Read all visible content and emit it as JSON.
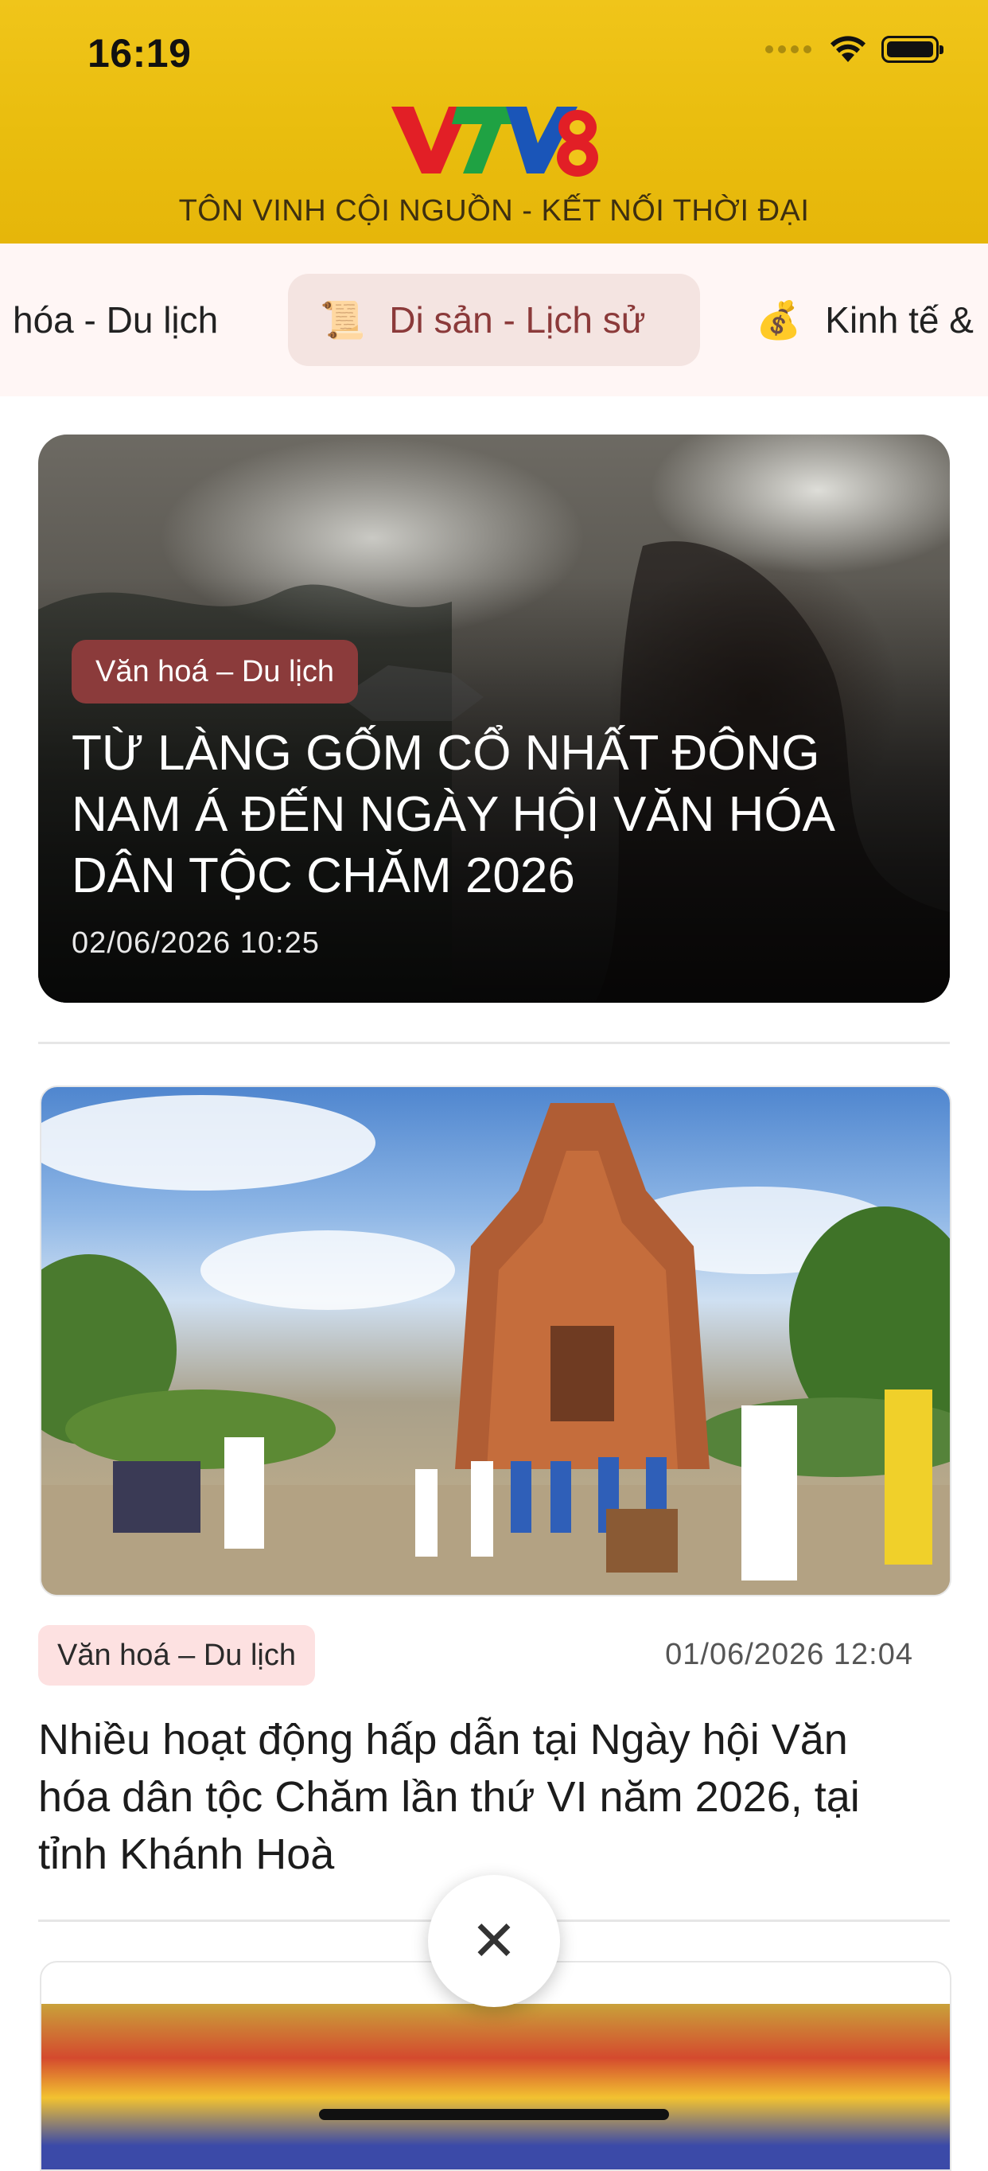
{
  "status_bar": {
    "time": "16:19",
    "icons": [
      "signal-icon",
      "wifi-icon",
      "battery-icon"
    ]
  },
  "header": {
    "logo_text": "VTV8",
    "tagline": "TÔN VINH CỘI NGUỒN - KẾT NỐI THỜI ĐẠI",
    "background_color": "#e9bd0e"
  },
  "tabs": [
    {
      "emoji": "",
      "label": "hóa - Du lịch",
      "selected": false
    },
    {
      "emoji": "📜",
      "label": "Di sản - Lịch sử",
      "selected": true
    },
    {
      "emoji": "💰",
      "label": "Kinh tế &",
      "selected": false
    }
  ],
  "featured": {
    "category": "Văn hoá – Du lịch",
    "title": "TỪ LÀNG GỐM CỔ NHẤT ĐÔNG NAM Á ĐẾN NGÀY HỘI VĂN HÓA DÂN TỘC CHĂM 2026",
    "date": "02/06/2026 10:25"
  },
  "articles": [
    {
      "category": "Văn hoá – Du lịch",
      "date": "01/06/2026 12:04",
      "title": "Nhiều hoạt động hấp dẫn tại Ngày hội Văn hóa dân tộc Chăm lần thứ VI năm 2026, tại tỉnh Khánh Hoà"
    }
  ],
  "close_button": {
    "icon": "close-icon",
    "glyph": "✕"
  },
  "colors": {
    "accent": "#8b3b3b",
    "badge_light": "#fde1e1",
    "tab_selected_bg": "#f4e4e1",
    "tabs_bg": "#fff6f5"
  }
}
